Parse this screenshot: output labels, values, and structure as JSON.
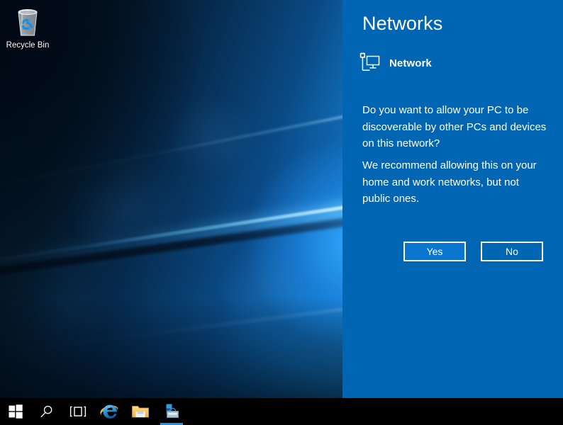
{
  "desktop": {
    "icons": [
      {
        "name": "recycle-bin",
        "label": "Recycle Bin"
      }
    ]
  },
  "taskbar": {
    "background": "#000000",
    "active_indicator_color": "#2a8fd8",
    "buttons": [
      {
        "icon": "windows-start-icon",
        "label": "Start",
        "active": false
      },
      {
        "icon": "search-icon",
        "label": "Search",
        "active": false
      },
      {
        "icon": "task-view-icon",
        "label": "Task View",
        "active": false
      },
      {
        "icon": "internet-explorer-icon",
        "label": "Internet Explorer",
        "active": false
      },
      {
        "icon": "file-explorer-icon",
        "label": "File Explorer",
        "active": false
      },
      {
        "icon": "windows-store-icon",
        "label": "Store",
        "active": true
      }
    ]
  },
  "flyout": {
    "title": "Networks",
    "background": "#0066b3",
    "network": {
      "icon": "network-monitor-icon",
      "label": "Network"
    },
    "question": "Do you want to allow your PC to be discoverable by other PCs and devices on this network?",
    "recommendation": "We recommend allowing this on your home and work networks, but not public ones.",
    "buttons": {
      "yes_label": "Yes",
      "no_label": "No",
      "primary_color": "#0a76cf",
      "border_color": "#ffffff"
    }
  }
}
